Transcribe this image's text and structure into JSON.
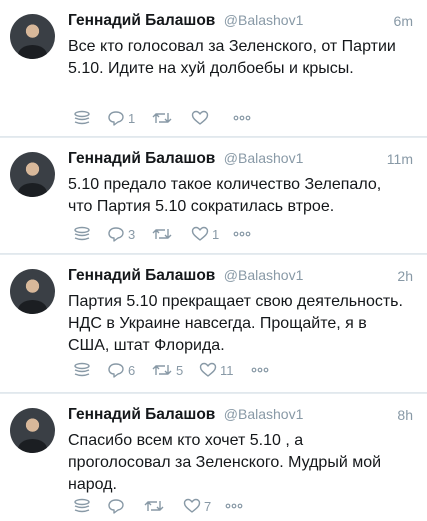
{
  "tweets": [
    {
      "name": "Геннадий Балашов",
      "handle": "@Balashov1",
      "time": "6m",
      "text": "Все кто голосовал за Зеленского, от Партии 5.10. Идите на хуй долбоебы и крысы.",
      "replies": "1",
      "retweets": "",
      "likes": ""
    },
    {
      "name": "Геннадий Балашов",
      "handle": "@Balashov1",
      "time": "11m",
      "text": "5.10 предало такое количество Зелепало, что Партия 5.10 сократилась втрое.",
      "replies": "3",
      "retweets": "",
      "likes": "1"
    },
    {
      "name": "Геннадий Балашов",
      "handle": "@Balashov1",
      "time": "2h",
      "text": "Партия 5.10 прекращает свою деятельность. НДС в Украине навсегда. Прощайте, я в США, штат Флорида.",
      "replies": "6",
      "retweets": "5",
      "likes": "11"
    },
    {
      "name": "Геннадий Балашов",
      "handle": "@Balashov1",
      "time": "8h",
      "text": "Спасибо всем кто хочет 5.10 , а проголосовал за Зеленского. Мудрый мой народ.",
      "replies": "",
      "retweets": "",
      "likes": "7"
    }
  ],
  "icons": {
    "analytics": "analytics-icon",
    "reply": "reply-icon",
    "retweet": "retweet-icon",
    "like": "like-icon",
    "more": "more-icon"
  },
  "colors": {
    "background": "#e6ecf0",
    "card": "#ffffff",
    "text": "#14171a",
    "muted": "#8899a6"
  }
}
